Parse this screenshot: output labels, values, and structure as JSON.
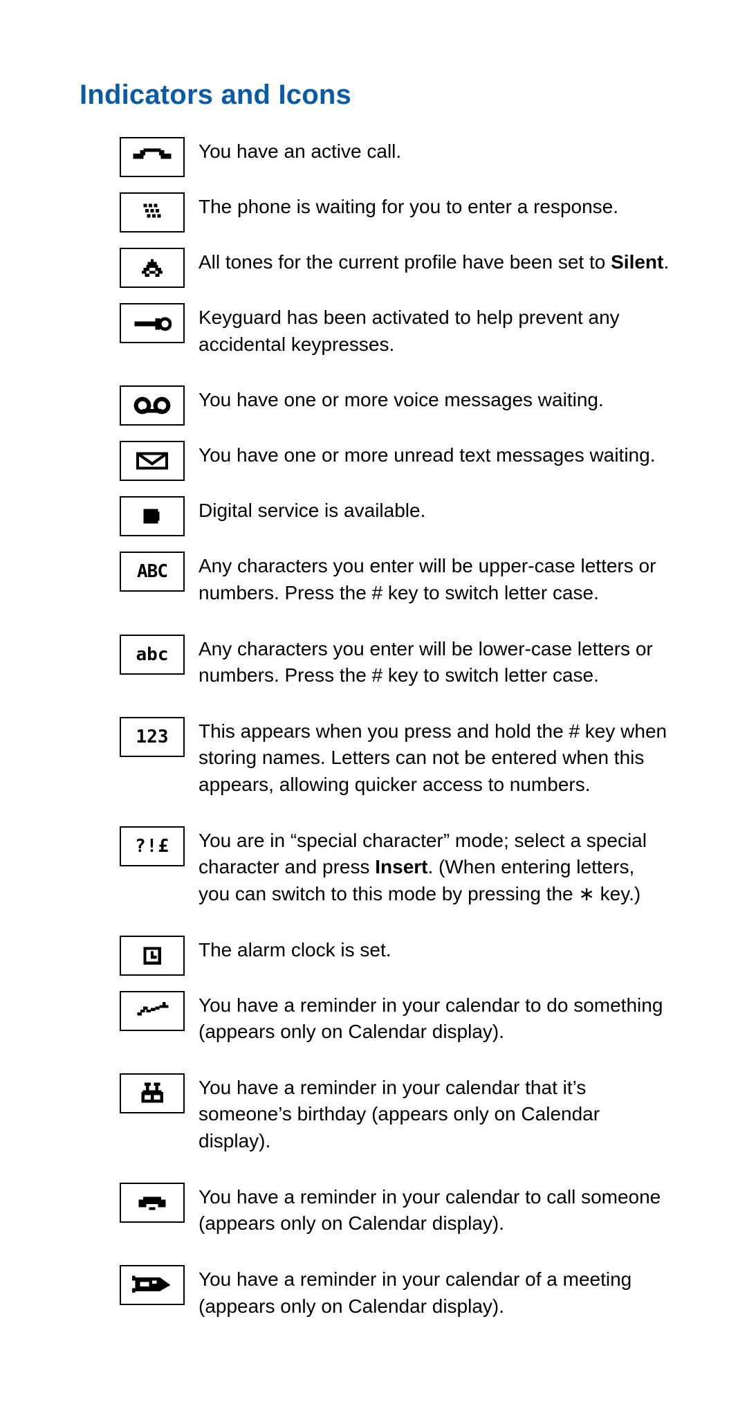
{
  "title": "Indicators and Icons",
  "rows": [
    {
      "text": "You have an active call."
    },
    {
      "text": "The phone is waiting for you to enter a response."
    },
    {
      "text": "All tones for the current profile have been set to ",
      "bold_after": "Silent",
      "tail": "."
    },
    {
      "text": "Keyguard has been activated to help prevent any accidental keypresses."
    },
    {
      "text": "You have one or more voice messages waiting."
    },
    {
      "text": "You have one or more unread text messages waiting."
    },
    {
      "text": "Digital service is available."
    },
    {
      "text": "Any characters you enter will be upper-case letters or numbers. Press the # key to switch letter case."
    },
    {
      "text": "Any characters you enter will be lower-case letters or numbers. Press the # key to switch letter case."
    },
    {
      "text": "This appears when you press and hold the # key when storing names. Letters can not be entered when this appears, allowing quicker access to numbers."
    },
    {
      "text": "You are in “special character” mode; select a special character and press ",
      "bold_after": "Insert",
      "tail": ". (When entering letters, you can switch to this mode by pressing the ∗ key.)"
    },
    {
      "text": "The alarm clock is set."
    },
    {
      "text": "You have a reminder in your calendar to do something (appears only on Calendar display)."
    },
    {
      "text": "You have a reminder in your calendar that it’s someone’s birthday (appears only on Calendar display)."
    },
    {
      "text": "You have a reminder in your calendar to call someone (appears only on Calendar display)."
    },
    {
      "text": "You have a reminder in your calendar of a meeting (appears only on Calendar display)."
    }
  ]
}
